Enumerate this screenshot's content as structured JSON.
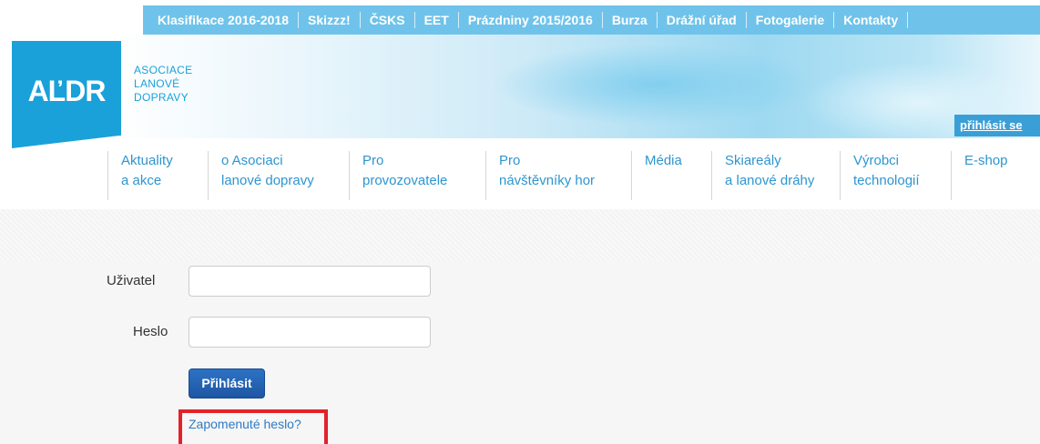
{
  "topbar": {
    "links": [
      "Klasifikace 2016-2018",
      "Skizzz!",
      "ČSKS",
      "EET",
      "Prázdniny 2015/2016",
      "Burza",
      "Drážní úřad",
      "Fotogalerie",
      "Kontakty"
    ]
  },
  "logo": {
    "mark": "AĽDR",
    "org_line1": "ASOCIACE",
    "org_line2": "LANOVÉ",
    "org_line3": "DOPRAVY"
  },
  "header": {
    "login_tab": "přihlásit se"
  },
  "nav": [
    {
      "l1": "Aktuality",
      "l2": "a akce"
    },
    {
      "l1": "o Asociaci",
      "l2": "lanové dopravy"
    },
    {
      "l1": "Pro",
      "l2": "provozovatele"
    },
    {
      "l1": "Pro",
      "l2": "návštěvníky hor"
    },
    {
      "l1": "Média",
      "l2": ""
    },
    {
      "l1": "Skiareály",
      "l2": "a lanové dráhy"
    },
    {
      "l1": "Výrobci",
      "l2": "technologií"
    },
    {
      "l1": "E-shop",
      "l2": ""
    }
  ],
  "form": {
    "user_label": "Uživatel",
    "user_value": "",
    "password_label": "Heslo",
    "password_value": "",
    "submit_label": "Přihlásit",
    "forgot_link": "Zapomenuté heslo?"
  },
  "colors": {
    "accent": "#1aa1d9",
    "topbar": "#6fc3ea",
    "button": "#1e56a3",
    "highlight": "#e2222a"
  }
}
